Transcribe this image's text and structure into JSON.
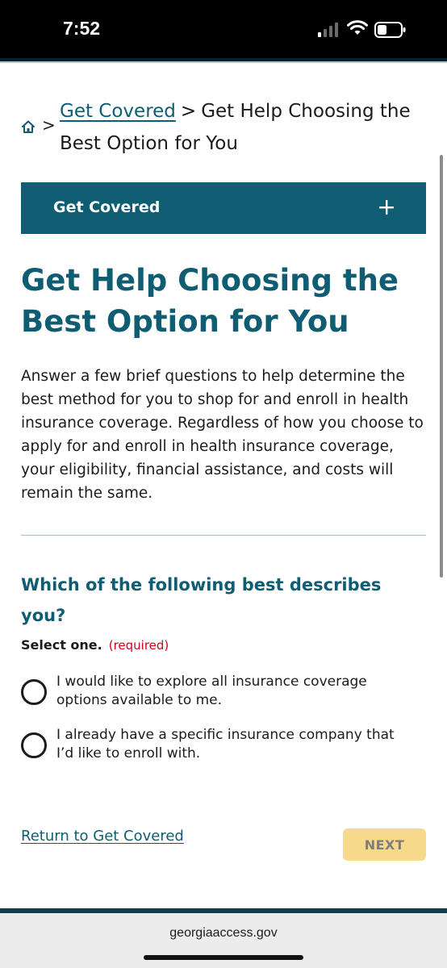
{
  "status_bar": {
    "time": "7:52",
    "icons": [
      "signal-icon",
      "wifi-icon",
      "battery-icon"
    ]
  },
  "breadcrumb": {
    "home_icon": "home-icon",
    "link": "Get Covered",
    "separator": ">",
    "current": "Get Help Choosing the Best Option for You"
  },
  "accordion": {
    "label": "Get Covered",
    "icon": "plus-icon"
  },
  "page": {
    "title": "Get Help Choosing the Best Option for You",
    "intro": "Answer a few brief questions to help determine the best method for you to shop for and enroll in health insurance coverage. Regardless of how you choose to apply for and enroll in health insurance coverage, your eligibility, financial assistance, and costs will remain the same."
  },
  "question": {
    "text": "Which of the following best describes you?",
    "select_label": "Select one.",
    "required": "(required)",
    "options": [
      "I would like to explore all insurance coverage options available to me.",
      "I already have a specific insurance company that I’d like to enroll with."
    ]
  },
  "footer": {
    "return_link": "Return to Get Covered",
    "next_label": "NEXT"
  },
  "browser": {
    "url": "georgiaaccess.gov"
  },
  "colors": {
    "brand": "#0f5d73",
    "required": "#d0021b",
    "next_button": "#f7d98b"
  }
}
